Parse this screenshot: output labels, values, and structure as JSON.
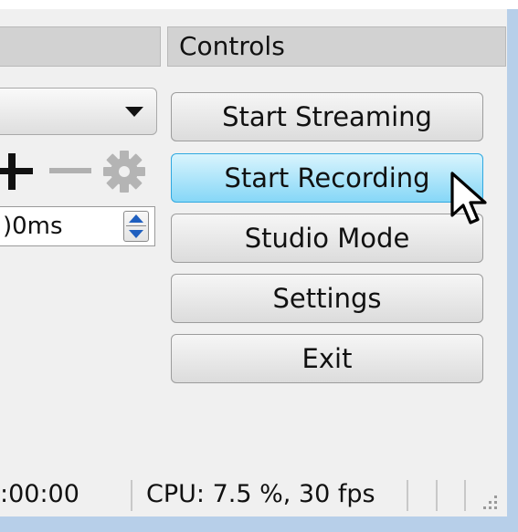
{
  "controls_dock": {
    "title": "Controls",
    "buttons": {
      "start_streaming": "Start Streaming",
      "start_recording": "Start Recording",
      "studio_mode": "Studio Mode",
      "settings": "Settings",
      "exit": "Exit"
    }
  },
  "transition_dock": {
    "duration_value": ")0ms"
  },
  "status_bar": {
    "time": ":00:00",
    "cpu": "CPU: 7.5 %, 30 fps"
  },
  "icons": {
    "combo": "chevron-down-icon",
    "add": "plus-icon",
    "remove": "minus-icon",
    "properties": "gear-icon",
    "spin": "spin-arrows-icon",
    "cursor": "mouse-pointer-icon",
    "grip": "resize-grip-icon"
  },
  "colors": {
    "hover_button": "#86d7f7",
    "hover_border": "#2fa8e0",
    "spin_arrows": "#1f5fbf",
    "window_border": "#b7cfe9"
  }
}
